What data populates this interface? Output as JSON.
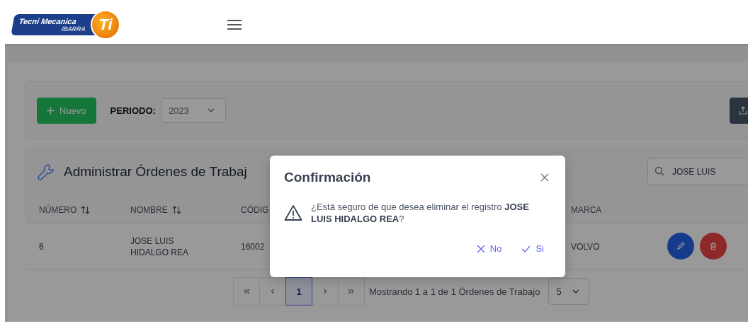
{
  "header": {
    "logo": {
      "line_1": "Tecni Mecanica",
      "line_2": "IBARRA",
      "mark": "Ti"
    }
  },
  "toolbar": {
    "new_button": "Nuevo",
    "period_label": "PERIODO:",
    "period_value": "2023"
  },
  "section": {
    "title": "Administrar Órdenes de Trabaj",
    "search_value": "JOSE LUIS"
  },
  "table": {
    "columns": [
      {
        "label": "NÚMERO",
        "sortable": true
      },
      {
        "label": "NOMBRE",
        "sortable": true
      },
      {
        "label": "CÓDIG",
        "sortable": false
      },
      {
        "label": "MARCA",
        "sortable": false
      }
    ],
    "rows": [
      [
        "6",
        "JOSE LUIS HIDALGO REA",
        "16002",
        "VOLVO"
      ]
    ]
  },
  "pagination": {
    "pages": [
      {
        "label": "1",
        "selected": true
      }
    ],
    "summary": "Mostrando 1 a 1 de 1 Órdenes de Trabajo",
    "rows_per_page": "5"
  },
  "dialog": {
    "title": "Confirmación",
    "message": "¿Está seguro de que desea eliminar el registro **JOSE LUIS HIDALGO REA**?",
    "buttons": [
      {
        "label": "No",
        "kind": "reject"
      },
      {
        "label": "Si",
        "kind": "accept"
      }
    ]
  }
}
